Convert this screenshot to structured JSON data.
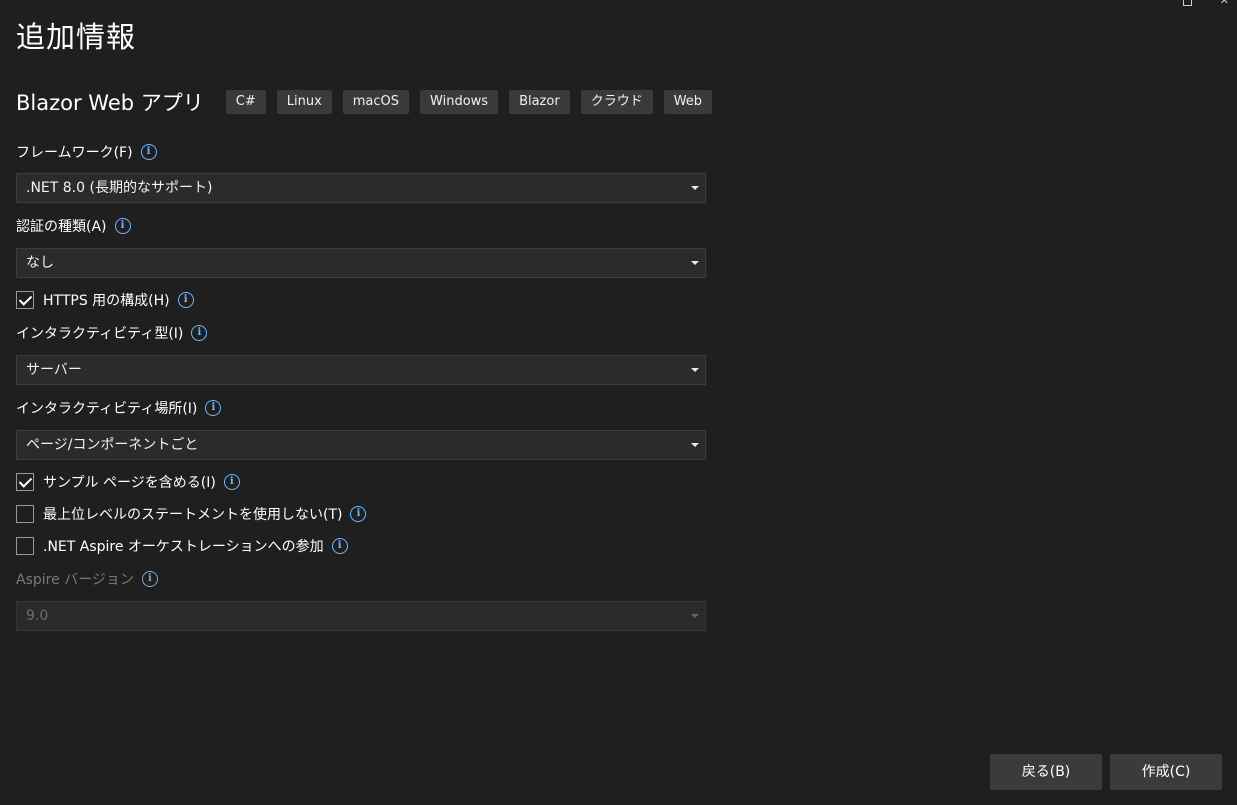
{
  "window": {
    "title": "追加情報"
  },
  "template": {
    "name": "Blazor Web アプリ",
    "tags": [
      "C#",
      "Linux",
      "macOS",
      "Windows",
      "Blazor",
      "クラウド",
      "Web"
    ]
  },
  "framework": {
    "label": "フレームワーク(F)",
    "value": ".NET 8.0 (長期的なサポート)"
  },
  "auth": {
    "label": "認証の種類(A)",
    "value": "なし"
  },
  "https": {
    "label": "HTTPS 用の構成(H)",
    "checked": true
  },
  "interactivity_type": {
    "label": "インタラクティビティ型(I)",
    "value": "サーバー"
  },
  "interactivity_location": {
    "label": "インタラクティビティ場所(I)",
    "value": "ページ/コンポーネントごと"
  },
  "sample_pages": {
    "label": "サンプル ページを含める(I)",
    "checked": true
  },
  "top_level": {
    "label": "最上位レベルのステートメントを使用しない(T)",
    "checked": false
  },
  "aspire": {
    "label": ".NET Aspire オーケストレーションへの参加",
    "checked": false
  },
  "aspire_version": {
    "label": "Aspire バージョン",
    "value": "9.0",
    "disabled": true
  },
  "buttons": {
    "back": "戻る(B)",
    "create": "作成(C)"
  },
  "colors": {
    "background": "#1f1f1f",
    "info_icon": "#6fb8ff",
    "tag_bg": "#3a3a3a",
    "button_bg": "#3b3b3b"
  }
}
